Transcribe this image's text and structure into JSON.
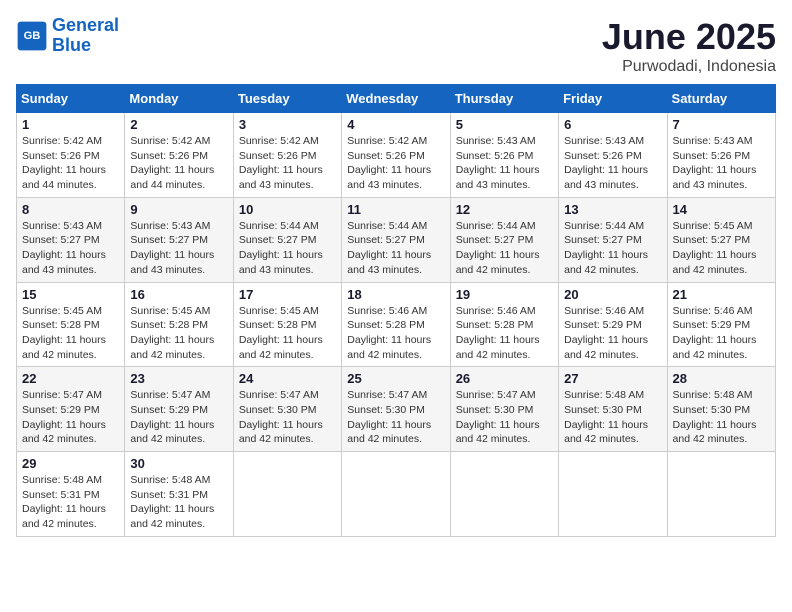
{
  "logo": {
    "line1": "General",
    "line2": "Blue"
  },
  "title": "June 2025",
  "location": "Purwodadi, Indonesia",
  "weekdays": [
    "Sunday",
    "Monday",
    "Tuesday",
    "Wednesday",
    "Thursday",
    "Friday",
    "Saturday"
  ],
  "weeks": [
    [
      {
        "day": "1",
        "sunrise": "5:42 AM",
        "sunset": "5:26 PM",
        "daylight": "11 hours and 44 minutes."
      },
      {
        "day": "2",
        "sunrise": "5:42 AM",
        "sunset": "5:26 PM",
        "daylight": "11 hours and 44 minutes."
      },
      {
        "day": "3",
        "sunrise": "5:42 AM",
        "sunset": "5:26 PM",
        "daylight": "11 hours and 43 minutes."
      },
      {
        "day": "4",
        "sunrise": "5:42 AM",
        "sunset": "5:26 PM",
        "daylight": "11 hours and 43 minutes."
      },
      {
        "day": "5",
        "sunrise": "5:43 AM",
        "sunset": "5:26 PM",
        "daylight": "11 hours and 43 minutes."
      },
      {
        "day": "6",
        "sunrise": "5:43 AM",
        "sunset": "5:26 PM",
        "daylight": "11 hours and 43 minutes."
      },
      {
        "day": "7",
        "sunrise": "5:43 AM",
        "sunset": "5:26 PM",
        "daylight": "11 hours and 43 minutes."
      }
    ],
    [
      {
        "day": "8",
        "sunrise": "5:43 AM",
        "sunset": "5:27 PM",
        "daylight": "11 hours and 43 minutes."
      },
      {
        "day": "9",
        "sunrise": "5:43 AM",
        "sunset": "5:27 PM",
        "daylight": "11 hours and 43 minutes."
      },
      {
        "day": "10",
        "sunrise": "5:44 AM",
        "sunset": "5:27 PM",
        "daylight": "11 hours and 43 minutes."
      },
      {
        "day": "11",
        "sunrise": "5:44 AM",
        "sunset": "5:27 PM",
        "daylight": "11 hours and 43 minutes."
      },
      {
        "day": "12",
        "sunrise": "5:44 AM",
        "sunset": "5:27 PM",
        "daylight": "11 hours and 42 minutes."
      },
      {
        "day": "13",
        "sunrise": "5:44 AM",
        "sunset": "5:27 PM",
        "daylight": "11 hours and 42 minutes."
      },
      {
        "day": "14",
        "sunrise": "5:45 AM",
        "sunset": "5:27 PM",
        "daylight": "11 hours and 42 minutes."
      }
    ],
    [
      {
        "day": "15",
        "sunrise": "5:45 AM",
        "sunset": "5:28 PM",
        "daylight": "11 hours and 42 minutes."
      },
      {
        "day": "16",
        "sunrise": "5:45 AM",
        "sunset": "5:28 PM",
        "daylight": "11 hours and 42 minutes."
      },
      {
        "day": "17",
        "sunrise": "5:45 AM",
        "sunset": "5:28 PM",
        "daylight": "11 hours and 42 minutes."
      },
      {
        "day": "18",
        "sunrise": "5:46 AM",
        "sunset": "5:28 PM",
        "daylight": "11 hours and 42 minutes."
      },
      {
        "day": "19",
        "sunrise": "5:46 AM",
        "sunset": "5:28 PM",
        "daylight": "11 hours and 42 minutes."
      },
      {
        "day": "20",
        "sunrise": "5:46 AM",
        "sunset": "5:29 PM",
        "daylight": "11 hours and 42 minutes."
      },
      {
        "day": "21",
        "sunrise": "5:46 AM",
        "sunset": "5:29 PM",
        "daylight": "11 hours and 42 minutes."
      }
    ],
    [
      {
        "day": "22",
        "sunrise": "5:47 AM",
        "sunset": "5:29 PM",
        "daylight": "11 hours and 42 minutes."
      },
      {
        "day": "23",
        "sunrise": "5:47 AM",
        "sunset": "5:29 PM",
        "daylight": "11 hours and 42 minutes."
      },
      {
        "day": "24",
        "sunrise": "5:47 AM",
        "sunset": "5:30 PM",
        "daylight": "11 hours and 42 minutes."
      },
      {
        "day": "25",
        "sunrise": "5:47 AM",
        "sunset": "5:30 PM",
        "daylight": "11 hours and 42 minutes."
      },
      {
        "day": "26",
        "sunrise": "5:47 AM",
        "sunset": "5:30 PM",
        "daylight": "11 hours and 42 minutes."
      },
      {
        "day": "27",
        "sunrise": "5:48 AM",
        "sunset": "5:30 PM",
        "daylight": "11 hours and 42 minutes."
      },
      {
        "day": "28",
        "sunrise": "5:48 AM",
        "sunset": "5:30 PM",
        "daylight": "11 hours and 42 minutes."
      }
    ],
    [
      {
        "day": "29",
        "sunrise": "5:48 AM",
        "sunset": "5:31 PM",
        "daylight": "11 hours and 42 minutes."
      },
      {
        "day": "30",
        "sunrise": "5:48 AM",
        "sunset": "5:31 PM",
        "daylight": "11 hours and 42 minutes."
      },
      null,
      null,
      null,
      null,
      null
    ]
  ]
}
